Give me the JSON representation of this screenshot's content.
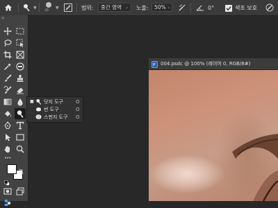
{
  "options_bar": {
    "range_label": "범위:",
    "range_value": "중간 영역",
    "exposure_label": "노출:",
    "exposure_value": "50%",
    "angle_value": "0°",
    "protect_tones_label": "색조 보호",
    "protect_tones_checked": true
  },
  "document": {
    "tab_title": "004.psdc @ 100% (레이어 0, RGB/8#)"
  },
  "flyout": {
    "items": [
      {
        "label": "닷지 도구",
        "shortcut": "O",
        "selected": true
      },
      {
        "label": "번 도구",
        "shortcut": "O",
        "selected": false
      },
      {
        "label": "스펀지 도구",
        "shortcut": "O",
        "selected": false
      }
    ]
  },
  "toolbar": {
    "collapse_label": "«",
    "more_label": "•••"
  },
  "colors": {
    "foreground": "#ffffff",
    "background": "#ffffff"
  }
}
